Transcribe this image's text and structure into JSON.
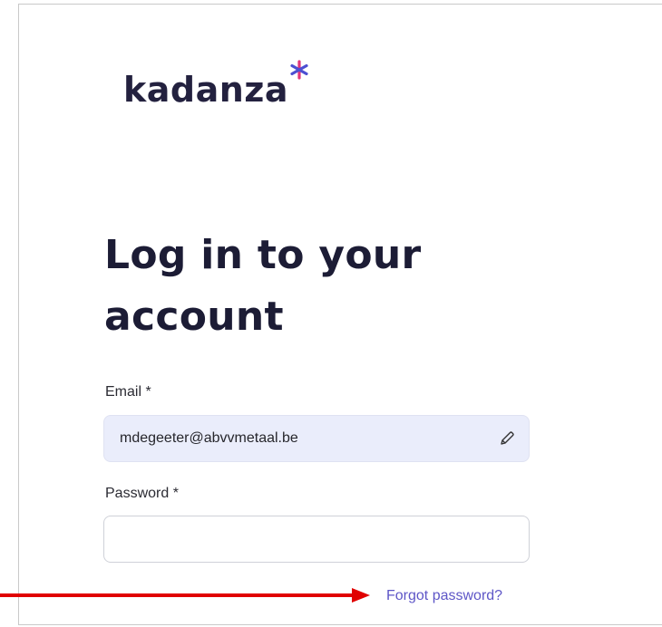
{
  "brand": {
    "name": "kadanza",
    "wordmark_color": "#23213f",
    "asterisk_colors": [
      "#e2357a",
      "#4d4fd1"
    ]
  },
  "page": {
    "title_line1": "Log in to your",
    "title_line2": "account"
  },
  "form": {
    "email_label": "Email *",
    "email_value": "mdegeeter@abvvmetaal.be",
    "password_label": "Password *",
    "password_value": "",
    "forgot_password_link": "Forgot password?",
    "edit_icon": "pencil-icon"
  },
  "annotation": {
    "arrow_color": "#e00000",
    "points_to": "forgot-password-link"
  },
  "colors": {
    "link": "#5e56c7",
    "email_field_bg": "#eaedfb",
    "heading": "#1c1c35"
  }
}
